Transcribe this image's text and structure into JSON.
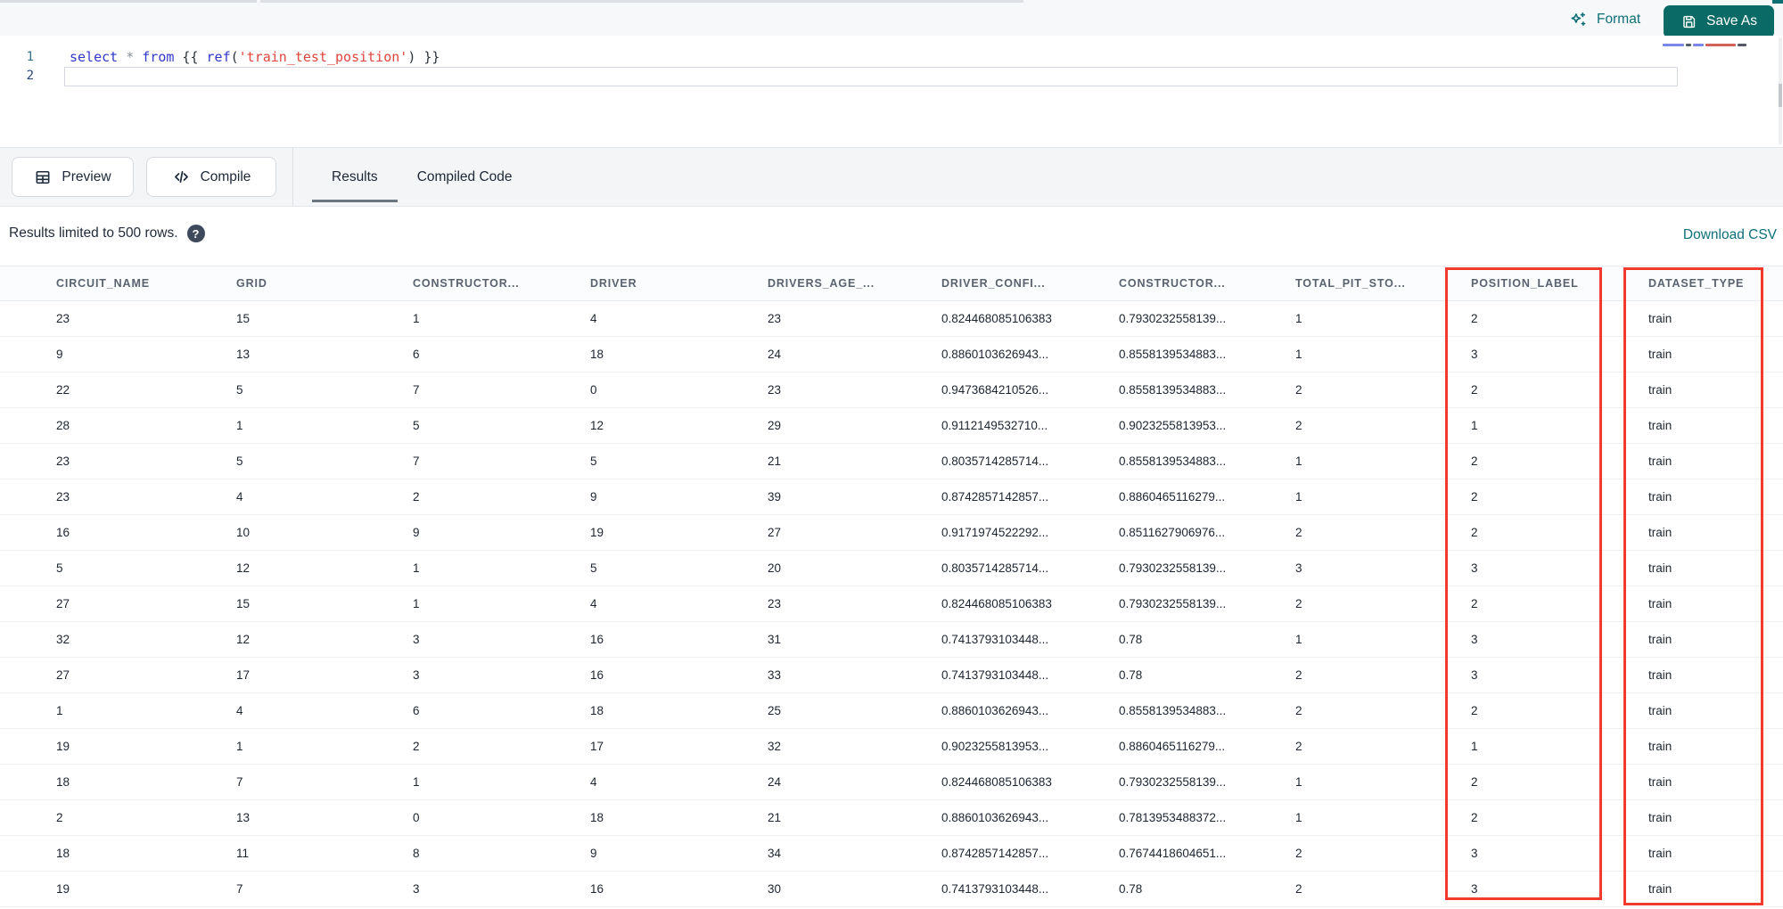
{
  "top_bar": {
    "format_label": "Format",
    "save_as_label": "Save As"
  },
  "editor": {
    "line_numbers": [
      "1",
      "2"
    ],
    "code_tokens": [
      {
        "text": "select",
        "type": "keyword"
      },
      {
        "text": " ",
        "type": "plain"
      },
      {
        "text": "*",
        "type": "operator"
      },
      {
        "text": " ",
        "type": "plain"
      },
      {
        "text": "from",
        "type": "keyword"
      },
      {
        "text": " {{ ",
        "type": "plain"
      },
      {
        "text": "ref",
        "type": "keyword"
      },
      {
        "text": "(",
        "type": "plain"
      },
      {
        "text": "'train_test_position'",
        "type": "string"
      },
      {
        "text": ") }}",
        "type": "plain"
      }
    ]
  },
  "toolbar": {
    "preview_label": "Preview",
    "compile_label": "Compile",
    "tabs": [
      {
        "label": "Results",
        "active": true
      },
      {
        "label": "Compiled Code",
        "active": false
      }
    ]
  },
  "results_bar": {
    "limit_text": "Results limited to 500 rows.",
    "help_glyph": "?",
    "download_label": "Download CSV"
  },
  "table": {
    "headers": [
      "CIRCUIT_NAME",
      "GRID",
      "CONSTRUCTOR...",
      "DRIVER",
      "DRIVERS_AGE_...",
      "DRIVER_CONFI...",
      "CONSTRUCTOR...",
      "TOTAL_PIT_STO...",
      "POSITION_LABEL",
      "DATASET_TYPE"
    ],
    "rows": [
      [
        "23",
        "15",
        "1",
        "4",
        "23",
        "0.824468085106383",
        "0.7930232558139...",
        "1",
        "2",
        "train"
      ],
      [
        "9",
        "13",
        "6",
        "18",
        "24",
        "0.8860103626943...",
        "0.8558139534883...",
        "1",
        "3",
        "train"
      ],
      [
        "22",
        "5",
        "7",
        "0",
        "23",
        "0.9473684210526...",
        "0.8558139534883...",
        "2",
        "2",
        "train"
      ],
      [
        "28",
        "1",
        "5",
        "12",
        "29",
        "0.9112149532710...",
        "0.9023255813953...",
        "2",
        "1",
        "train"
      ],
      [
        "23",
        "5",
        "7",
        "5",
        "21",
        "0.8035714285714...",
        "0.8558139534883...",
        "1",
        "2",
        "train"
      ],
      [
        "23",
        "4",
        "2",
        "9",
        "39",
        "0.8742857142857...",
        "0.8860465116279...",
        "1",
        "2",
        "train"
      ],
      [
        "16",
        "10",
        "9",
        "19",
        "27",
        "0.9171974522292...",
        "0.8511627906976...",
        "2",
        "2",
        "train"
      ],
      [
        "5",
        "12",
        "1",
        "5",
        "20",
        "0.8035714285714...",
        "0.7930232558139...",
        "3",
        "3",
        "train"
      ],
      [
        "27",
        "15",
        "1",
        "4",
        "23",
        "0.824468085106383",
        "0.7930232558139...",
        "2",
        "2",
        "train"
      ],
      [
        "32",
        "12",
        "3",
        "16",
        "31",
        "0.7413793103448...",
        "0.78",
        "1",
        "3",
        "train"
      ],
      [
        "27",
        "17",
        "3",
        "16",
        "33",
        "0.7413793103448...",
        "0.78",
        "2",
        "3",
        "train"
      ],
      [
        "1",
        "4",
        "6",
        "18",
        "25",
        "0.8860103626943...",
        "0.8558139534883...",
        "2",
        "2",
        "train"
      ],
      [
        "19",
        "1",
        "2",
        "17",
        "32",
        "0.9023255813953...",
        "0.8860465116279...",
        "2",
        "1",
        "train"
      ],
      [
        "18",
        "7",
        "1",
        "4",
        "24",
        "0.824468085106383",
        "0.7930232558139...",
        "1",
        "2",
        "train"
      ],
      [
        "2",
        "13",
        "0",
        "18",
        "21",
        "0.8860103626943...",
        "0.7813953488372...",
        "1",
        "2",
        "train"
      ],
      [
        "18",
        "11",
        "8",
        "9",
        "34",
        "0.8742857142857...",
        "0.7674418604651...",
        "2",
        "3",
        "train"
      ],
      [
        "19",
        "7",
        "3",
        "16",
        "30",
        "0.7413793103448...",
        "0.78",
        "2",
        "3",
        "train"
      ]
    ],
    "highlighted_columns": [
      "POSITION_LABEL",
      "DATASET_TYPE"
    ]
  },
  "colors": {
    "accent_teal": "#0e6f78",
    "save_button_bg": "#0a6a66",
    "annotation_red": "#f23a2e"
  }
}
